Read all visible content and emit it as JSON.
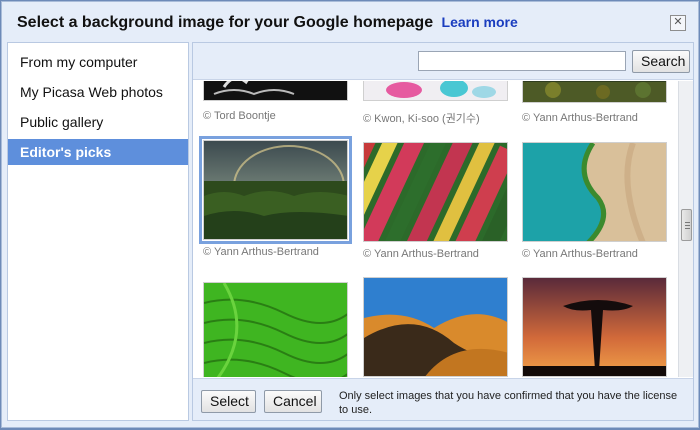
{
  "dialog": {
    "title": "Select a background image for your Google homepage",
    "learn_more": "Learn more",
    "close_symbol": "✕"
  },
  "sidebar": {
    "items": [
      {
        "label": "From my computer",
        "selected": false
      },
      {
        "label": "My Picasa Web photos",
        "selected": false
      },
      {
        "label": "Public gallery",
        "selected": false
      },
      {
        "label": "Editor's picks",
        "selected": true
      }
    ]
  },
  "search": {
    "value": "",
    "button_label": "Search"
  },
  "gallery": {
    "credits_row1": [
      "© Tord Boontje",
      "© Kwon, Ki-soo (권기수)",
      "© Yann Arthus-Bertrand"
    ],
    "credits_row2": [
      "© Yann Arthus-Bertrand",
      "© Yann Arthus-Bertrand",
      "© Yann Arthus-Bertrand"
    ],
    "selected_index": 0
  },
  "footer": {
    "select_label": "Select",
    "cancel_label": "Cancel",
    "license_note": "Only select images that you have confirmed that you have the license to use."
  },
  "colors": {
    "accent": "#5e8fdc",
    "link": "#1a3dbf",
    "dialog_bg": "#e5edf9"
  },
  "icons": {
    "close": "close-icon",
    "scroll_grip": "grip-icon"
  }
}
